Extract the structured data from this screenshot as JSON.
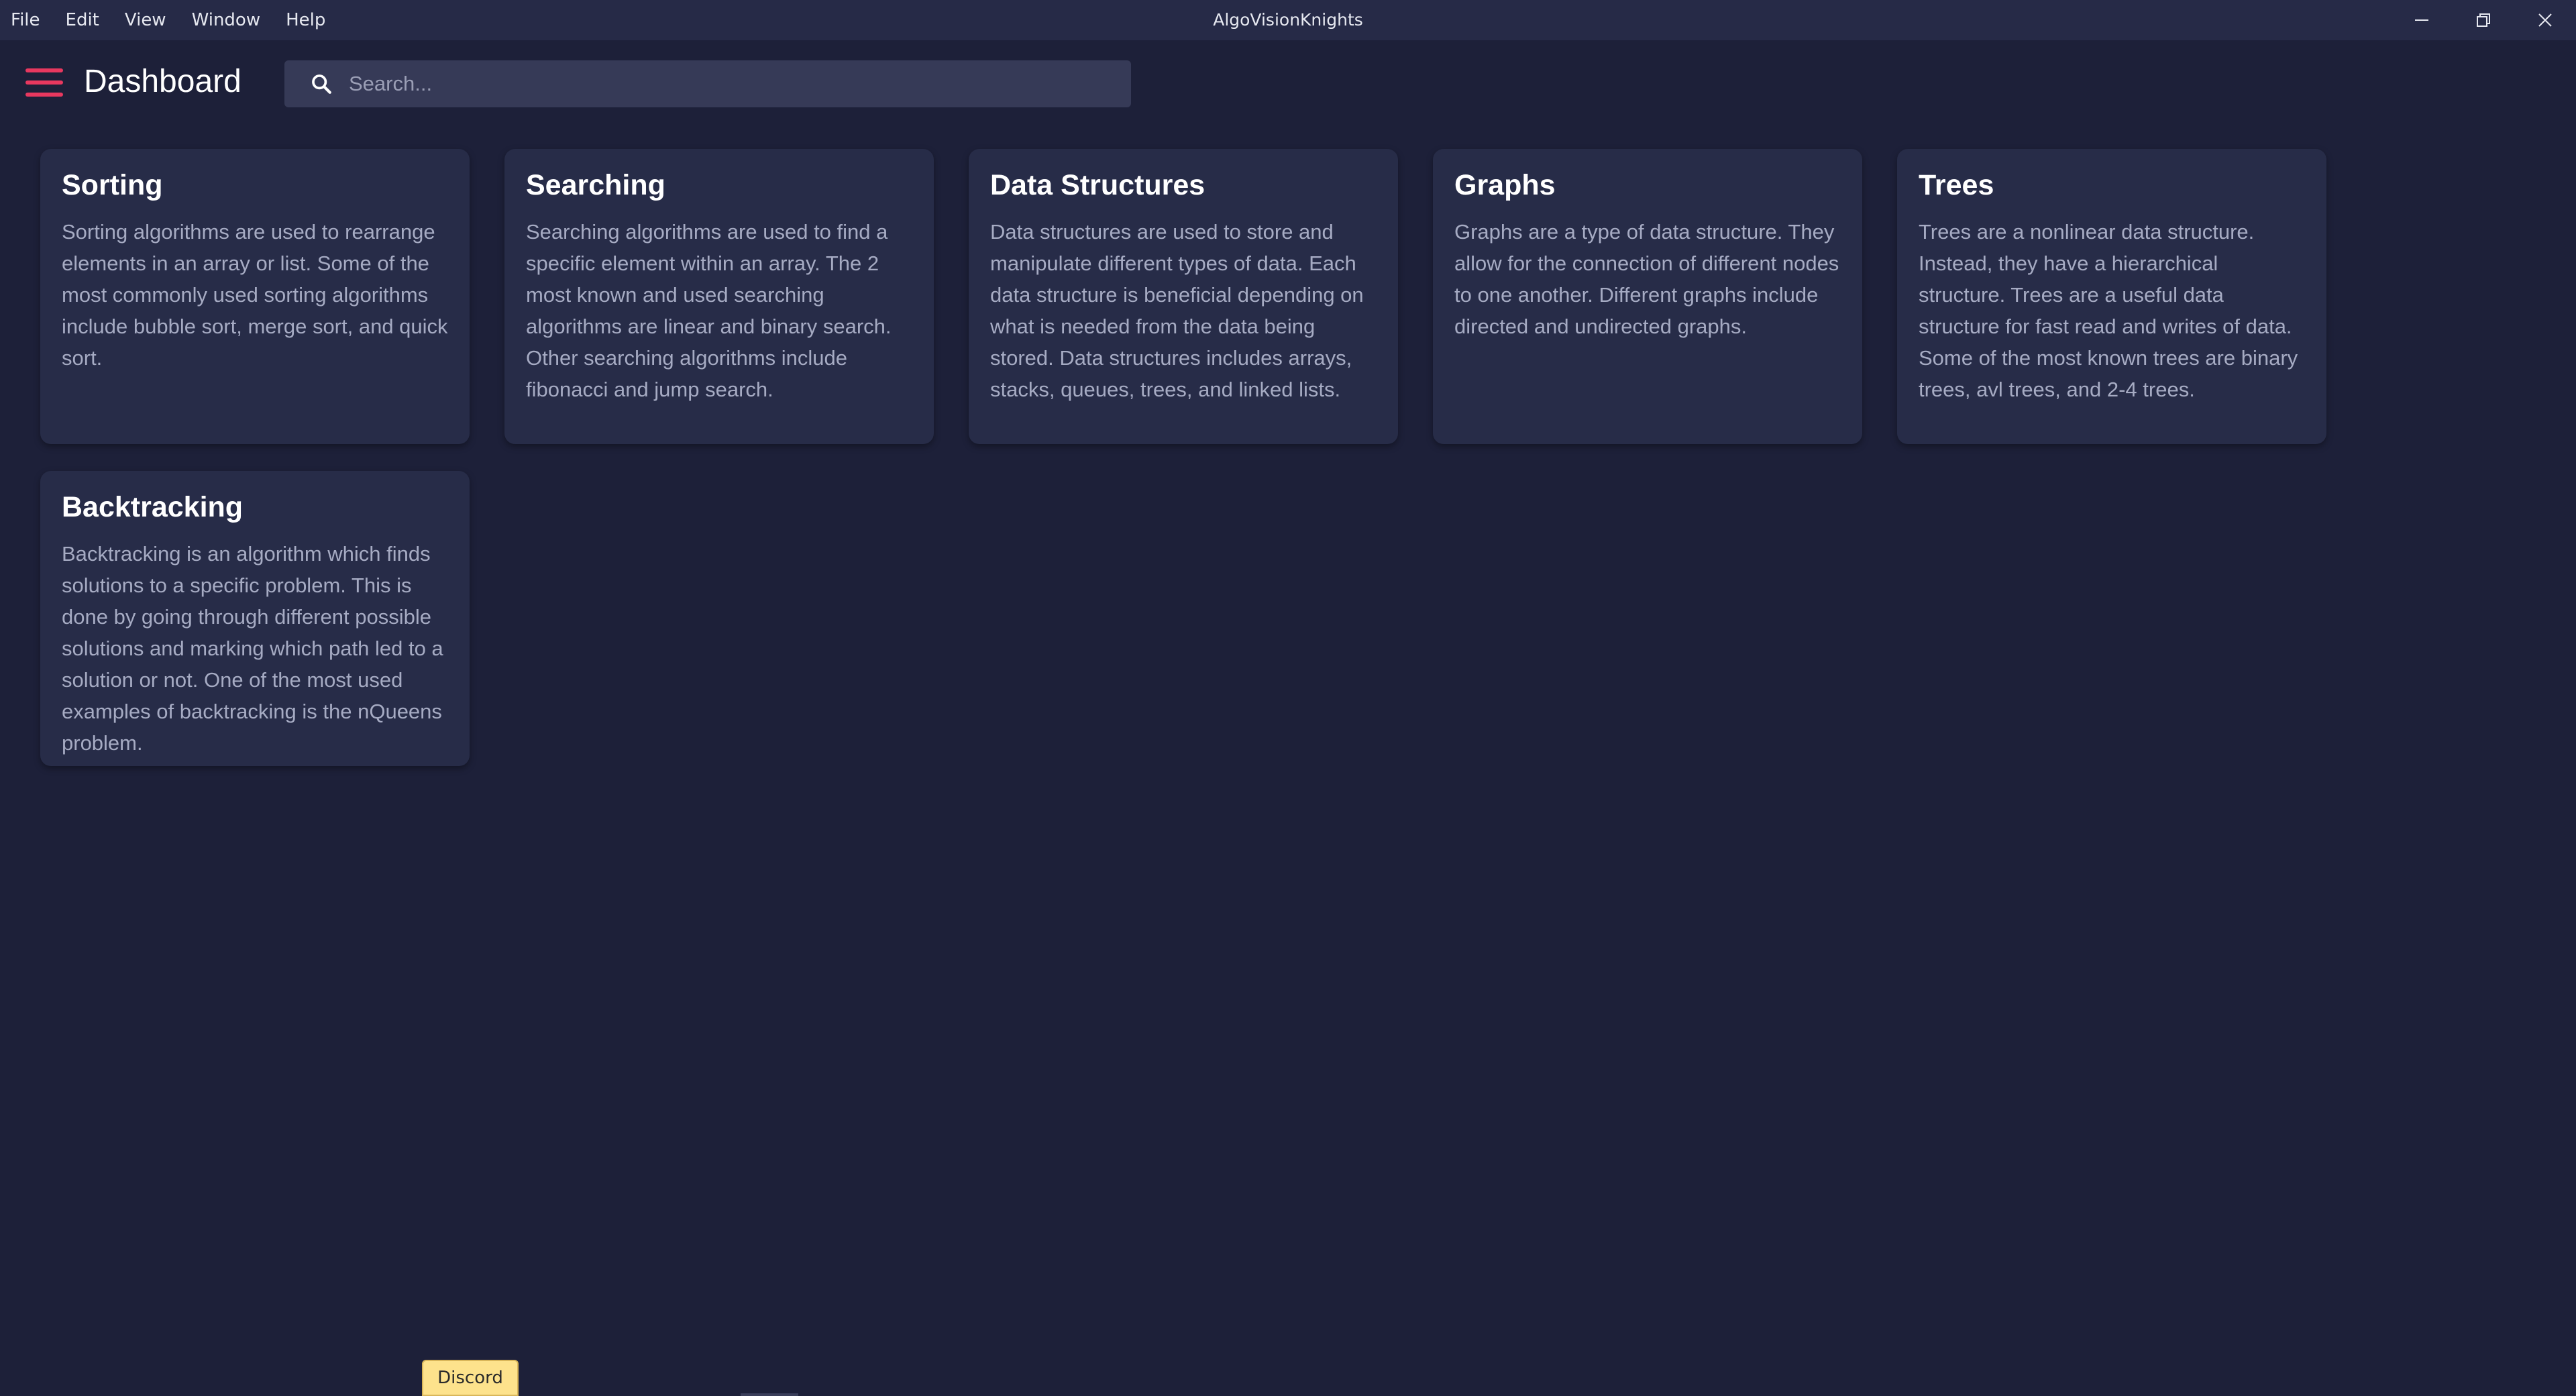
{
  "window": {
    "title": "AlgoVisionKnights",
    "menu": [
      "File",
      "Edit",
      "View",
      "Window",
      "Help"
    ]
  },
  "header": {
    "title": "Dashboard",
    "search_placeholder": "Search..."
  },
  "cards": [
    {
      "title": "Sorting",
      "text": "Sorting algorithms are used to rearrange elements in an array or list. Some of the most commonly used sorting algorithms include bubble sort, merge sort, and quick sort."
    },
    {
      "title": "Searching",
      "text": "Searching algorithms are used to find a specific element within an array. The 2 most known and used searching algorithms are linear and binary search. Other searching algorithms include fibonacci and jump search."
    },
    {
      "title": "Data Structures",
      "text": "Data structures are used to store and manipulate different types of data. Each data structure is beneficial depending on what is needed from the data being stored. Data structures includes arrays, stacks, queues, trees, and linked lists."
    },
    {
      "title": "Graphs",
      "text": "Graphs are a type of data structure. They allow for the connection of different nodes to one another. Different graphs include directed and undirected graphs."
    },
    {
      "title": "Trees",
      "text": "Trees are a nonlinear data structure. Instead, they have a hierarchical structure. Trees are a useful data structure for fast read and writes of data. Some of the most known trees are binary trees, avl trees, and 2-4 trees."
    },
    {
      "title": "Backtracking",
      "text": "Backtracking is an algorithm which finds solutions to a specific problem. This is done by going through different possible solutions and marking which path led to a solution or not. One of the most used examples of backtracking is the nQueens problem."
    }
  ],
  "footer": {
    "discord_label": "Discord"
  },
  "colors": {
    "background": "#1d2039",
    "card": "#272c48",
    "accent": "#e8385f",
    "discord": "#fde28c"
  }
}
